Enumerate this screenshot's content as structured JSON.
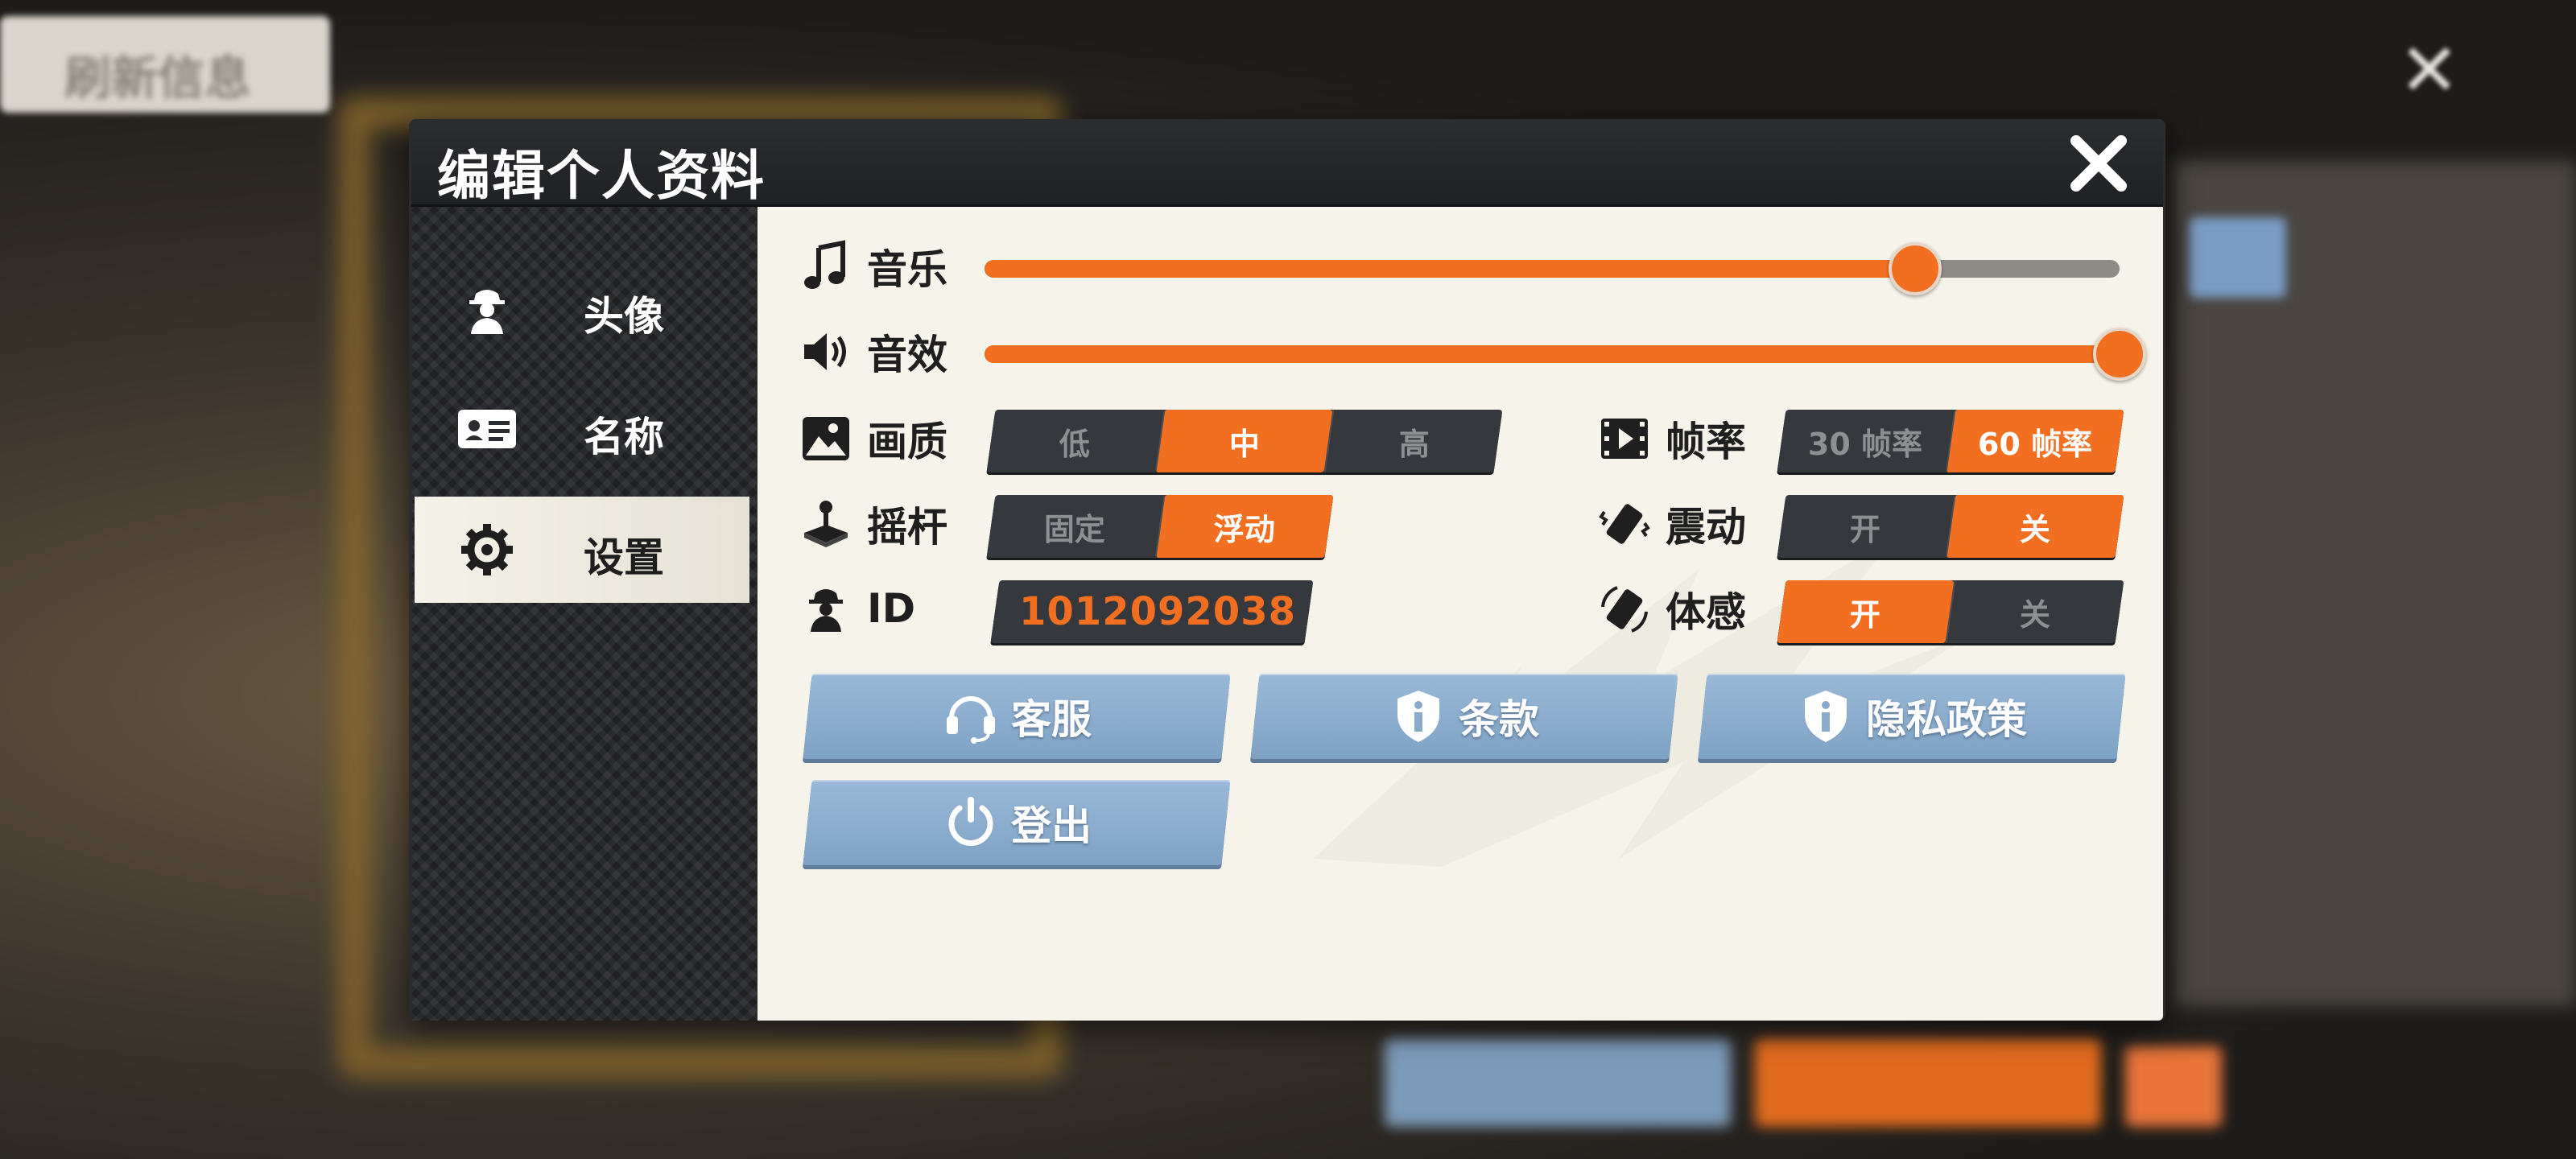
{
  "background": {
    "top_left_button_label": "刷新信息"
  },
  "dialog": {
    "title": "编辑个人资料"
  },
  "sidebar": {
    "items": [
      {
        "label": "头像",
        "icon": "avatar-icon",
        "active": false
      },
      {
        "label": "名称",
        "icon": "id-card-icon",
        "active": false
      },
      {
        "label": "设置",
        "icon": "gear-icon",
        "active": true
      }
    ]
  },
  "settings": {
    "music": {
      "label": "音乐",
      "icon": "music-note-icon",
      "level": 0.82
    },
    "sfx": {
      "label": "音效",
      "icon": "speaker-icon",
      "level": 1.0
    },
    "quality": {
      "label": "画质",
      "icon": "image-icon",
      "options": [
        "低",
        "中",
        "高"
      ],
      "selected": "中"
    },
    "framerate": {
      "label": "帧率",
      "icon": "film-icon",
      "options": [
        "30 帧率",
        "60 帧率"
      ],
      "selected": "60 帧率"
    },
    "joystick": {
      "label": "摇杆",
      "icon": "joystick-icon",
      "options": [
        "固定",
        "浮动"
      ],
      "selected": "浮动"
    },
    "vibration": {
      "label": "震动",
      "icon": "vibrate-icon",
      "options": [
        "开",
        "关"
      ],
      "selected": "关"
    },
    "motion": {
      "label": "体感",
      "icon": "motion-icon",
      "options": [
        "开",
        "关"
      ],
      "selected": "开"
    },
    "id": {
      "label": "ID",
      "icon": "spy-icon",
      "value": "1012092038"
    }
  },
  "buttons": {
    "support": "客服",
    "terms": "条款",
    "privacy": "隐私政策",
    "logout": "登出"
  },
  "colors": {
    "accent": "#f26f22",
    "button_blue": "#88aacb",
    "panel_bg": "#f5f3ea",
    "dark": "#1a1b1d"
  }
}
